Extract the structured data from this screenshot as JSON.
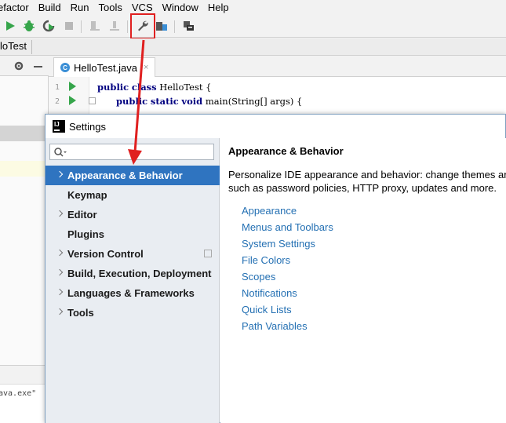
{
  "menubar": {
    "items": [
      "efactor",
      "Build",
      "Run",
      "Tools",
      "VCS",
      "Window",
      "Help"
    ]
  },
  "toolbar": {
    "buttons": [
      "run-icon",
      "debug-icon",
      "coverage-icon",
      "stop-icon",
      "build-icon",
      "rebuild-icon",
      "settings-wrench-icon",
      "project-structure-icon",
      "sdk-icon"
    ]
  },
  "navbar": {
    "crumb": "loTest"
  },
  "editor": {
    "tab_label": "HelloTest.java",
    "line1_num": "1",
    "line2_num": "2",
    "line1_kw1": "public",
    "line1_kw2": "class",
    "line1_rest": " HelloTest {",
    "line2_kw1": "public",
    "line2_kw2": "static",
    "line2_kw3": "void",
    "line2_rest": " main(String[] args) {"
  },
  "console": {
    "text": "ava.exe\""
  },
  "dialog": {
    "title": "Settings",
    "search_placeholder": "",
    "tree": [
      {
        "label": "Appearance & Behavior",
        "expandable": true,
        "selected": true
      },
      {
        "label": "Keymap",
        "expandable": false
      },
      {
        "label": "Editor",
        "expandable": true
      },
      {
        "label": "Plugins",
        "expandable": false
      },
      {
        "label": "Version Control",
        "expandable": true
      },
      {
        "label": "Build, Execution, Deployment",
        "expandable": true
      },
      {
        "label": "Languages & Frameworks",
        "expandable": true
      },
      {
        "label": "Tools",
        "expandable": true
      }
    ],
    "right": {
      "title": "Appearance & Behavior",
      "desc_line1": "Personalize IDE appearance and behavior: change themes ar",
      "desc_line2": "such as password policies, HTTP proxy, updates and more.",
      "links": [
        "Appearance",
        "Menus and Toolbars",
        "System Settings",
        "File Colors",
        "Scopes",
        "Notifications",
        "Quick Lists",
        "Path Variables"
      ]
    }
  },
  "colors": {
    "selection": "#2f74c0",
    "link": "#2470b3",
    "annotation_red": "#e02020",
    "run_green": "#36a54b"
  }
}
